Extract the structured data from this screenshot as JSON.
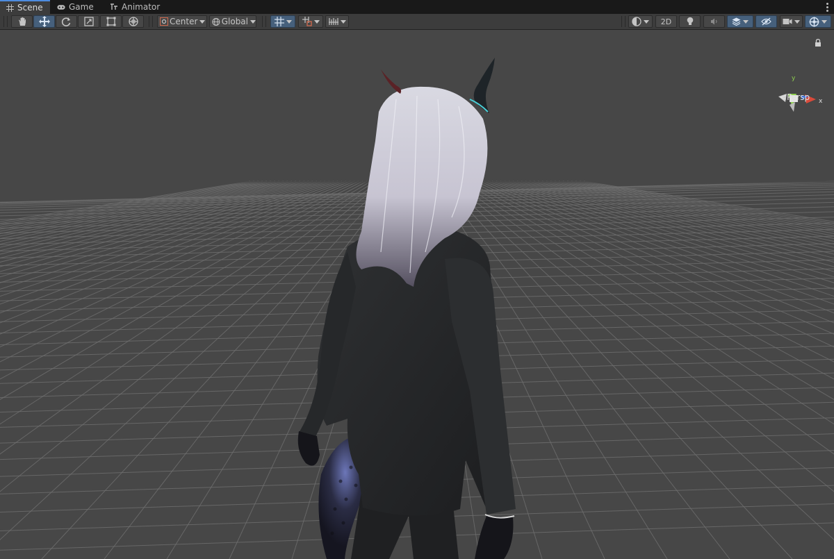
{
  "tabs": [
    {
      "label": "Scene",
      "icon": "grid-icon",
      "active": true
    },
    {
      "label": "Game",
      "icon": "gamepad-icon",
      "active": false
    },
    {
      "label": "Animator",
      "icon": "animator-icon",
      "active": false
    }
  ],
  "toolbar": {
    "pivot_mode": "Center",
    "pivot_rotation": "Global",
    "mode_2d": "2D"
  },
  "gizmo": {
    "y_label": "y",
    "x_label": "x",
    "projection": "Persp"
  },
  "colors": {
    "accent": "#46607c",
    "viewport_bg": "#474747",
    "grid_line": "#6e6e6e",
    "axis_x": "#d94a3a",
    "axis_y": "#8fd14f",
    "axis_z": "#3a6fd9"
  }
}
